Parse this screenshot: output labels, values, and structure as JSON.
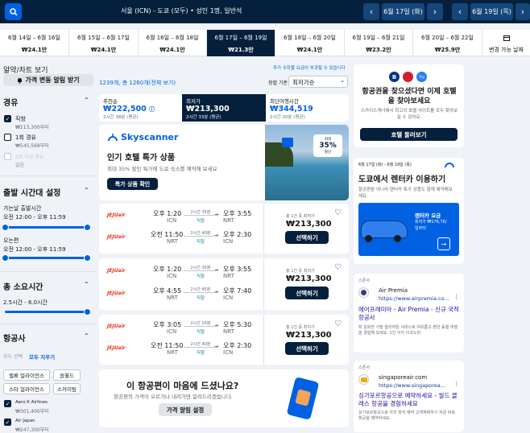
{
  "top": {
    "route": "서울 (ICN) - 도쿄 (모두) • 성인 1명, 일반석",
    "depart": "6월 17일 (화)",
    "return": "6월 19일 (목)"
  },
  "dates": [
    {
      "d": "6월 14일 – 6월 16일",
      "p": "₩24.1만"
    },
    {
      "d": "6월 15일 – 6월 17일",
      "p": "₩24.1만"
    },
    {
      "d": "6월 16일 – 6월 18일",
      "p": "₩24.1만"
    },
    {
      "d": "6월 17일 – 6월 19일",
      "p": "₩21.3만"
    },
    {
      "d": "6월 18일 – 6월 20일",
      "p": "₩24.1만"
    },
    {
      "d": "6월 19일 – 6월 21일",
      "p": "₩23.2만"
    },
    {
      "d": "6월 20일 – 6월 22일",
      "p": "₩25.9만"
    }
  ],
  "flex_label": "변경 가능 날짜",
  "side": {
    "promo_link": "알약/차트 보기",
    "alert_btn": "가격 변동 알림 받기",
    "stops_title": "경유",
    "stops": [
      {
        "label": "직항",
        "sub": "₩213,300부터",
        "on": true
      },
      {
        "label": "1회 경유",
        "sub": "₩545,569부터",
        "on": false
      },
      {
        "label": "2회 이상 경유",
        "sub": "없음",
        "on": false,
        "dis": true
      }
    ],
    "time_title": "출발 시간대 설정",
    "out_label": "가는날 출발시간",
    "out_range": "오전 12:00 - 오후 11:59",
    "ret_label": "오는편",
    "ret_range": "오전 12:00 - 오후 11:59",
    "dur_title": "총 소요시간",
    "dur_range": "2.5시간 - 6.0시간",
    "air_title": "항공사",
    "clear_all": "모두 선택",
    "clear_none": "모두 지우기",
    "alliances": [
      "밸류 얼라이언스",
      "원월드",
      "스타 얼라이언스",
      "스카이팀"
    ],
    "airlines": [
      {
        "name": "Aero K Airlines",
        "price": "₩301,400부터"
      },
      {
        "name": "Air Japan",
        "price": "₩247,300부터"
      }
    ]
  },
  "main": {
    "fee_note": "추가 수하물 요금이 부과될 수 있습니다",
    "count": "1239개, 총 1260개(전체 보기)",
    "sort_label": "정렬 기준",
    "sort_value": "최저가순",
    "tabs": [
      {
        "t": "추천순",
        "p": "₩222,500",
        "s": "2시간 38분 (평균)"
      },
      {
        "t": "최저가",
        "p": "₩213,300",
        "s": "2시간 33분 (평균)"
      },
      {
        "t": "최단여행시간",
        "p": "₩344,519",
        "s": "2시간 20분 (평균)"
      }
    ],
    "ad": {
      "brand": "Skyscanner",
      "title": "인기 호텔 특가 상품",
      "desc": "최대 35% 할인 특가에 도쿄 숙소를 예약해 보세요",
      "btn": "특가 상품 확인",
      "badge_top": "최대",
      "badge_pct": "35%",
      "badge_bot": "할인"
    },
    "results": [
      {
        "legs": [
          {
            "airline": "JEJUair",
            "dep": "오후 1:20",
            "from": "ICN",
            "dur": "2시간 35분",
            "dir": "직항",
            "arr": "오후 3:55",
            "to": "NRT"
          },
          {
            "airline": "JEJUair",
            "dep": "오전 11:50",
            "from": "NRT",
            "dur": "2시간 40분",
            "dir": "직항",
            "arr": "오후 2:30",
            "to": "ICN"
          }
        ],
        "note": "총 1건 중 최저가",
        "price": "₩213,300",
        "btn": "선택하기"
      },
      {
        "legs": [
          {
            "airline": "JEJUair",
            "dep": "오후 1:20",
            "from": "ICN",
            "dur": "2시간 35분",
            "dir": "직항",
            "arr": "오후 3:55",
            "to": "NRT"
          },
          {
            "airline": "JEJUair",
            "dep": "오후 4:55",
            "from": "NRT",
            "dur": "2시간 45분",
            "dir": "직항",
            "arr": "오후 7:40",
            "to": "ICN"
          }
        ],
        "note": "총 1건 중 최저가",
        "price": "₩213,300",
        "btn": "선택하기"
      },
      {
        "legs": [
          {
            "airline": "JEJUair",
            "dep": "오후 3:05",
            "from": "ICN",
            "dur": "2시간 25분",
            "dir": "직항",
            "arr": "오후 5:30",
            "to": "NRT"
          },
          {
            "airline": "JEJUair",
            "dep": "오전 11:50",
            "from": "NRT",
            "dur": "2시간 40분",
            "dir": "직항",
            "arr": "오후 2:30",
            "to": "ICN"
          }
        ],
        "note": "총 1건 중 최저가",
        "price": "₩213,300",
        "btn": "선택하기"
      }
    ],
    "alert": {
      "title": "이 항공편이 마음에 드셨나요?",
      "desc": "항공편의 가격이 오르거나 내려가면 알려드리겠습니다.",
      "btn": "가격 알림 설정"
    }
  },
  "right": {
    "hotel": {
      "logos": [
        "B",
        "Trip"
      ],
      "title": "항공권을 찾으셨다면 이제 호텔을 찾아보세요",
      "desc": "스카이스캐너에서 최고의 호텔 사이트를 모두 찾아보실 수 있어요.",
      "btn": "호텔 둘러보기"
    },
    "car": {
      "date": "6월 17일 (화) - 6월 19일 (목)",
      "title": "도쿄에서 렌터카 이용하기",
      "desc": "항공편뿐 아니라 렌터카 특가 상품도 함께 예약해보세요.",
      "badge1": "렌터카 요금",
      "badge2": "최저가 ₩176,76/",
      "badge3": "일부터"
    },
    "ads": [
      {
        "label": "스폰서",
        "name": "Air Premia",
        "url": "https://www.airpremia.co...",
        "title": "에어프레미아 - Air Premia - 신규 국적 항공사",
        "desc": "최 일회한 가장 합리하임 서비스로 여유롭고 편안 동행 여행을 경험해 보세요. 1인 이지 이코노미"
      },
      {
        "label": "스폰서",
        "name": "singaporeair.com",
        "url": "https://www.singaporea...",
        "title": "싱가포르항공으로 예약하세요 - 월드 클래스 항공을 경험하세요",
        "desc": "싱가포르항공으로 우리 좌석 예약 고객계획하기 지금 바로 항공을 예약하세요."
      }
    ]
  }
}
